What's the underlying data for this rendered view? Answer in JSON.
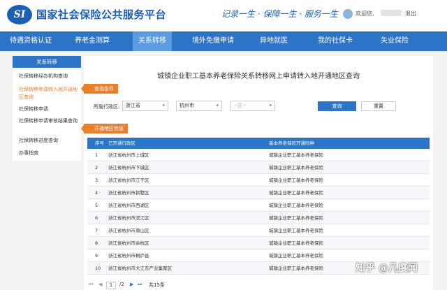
{
  "header": {
    "logo_text": "SI",
    "site_title": "国家社会保险公共服务平台",
    "slogan": "记录一生 · 保障一生 · 服务一生",
    "welcome": "欢迎您,",
    "logout": "退出"
  },
  "nav": [
    "待遇资格认证",
    "养老金测算",
    "关系转移",
    "境外免缴申请",
    "异地就医",
    "我的社保卡",
    "失业保险"
  ],
  "sidebar": {
    "header": "关系转移",
    "items": [
      "社保转移经办机构查询",
      "社保转移申请转入地开通地区查询",
      "社保转移申请",
      "社保转移申请审核结果查询",
      "社保转移进度查询",
      "办事指南"
    ]
  },
  "main": {
    "title": "城镇企业职工基本养老保险关系转移网上申请转入地开通地区查询",
    "query_tag": "查询条件",
    "filter_label": "所属行政区:",
    "province": "浙江省",
    "city": "杭州市",
    "district_placeholder": "--区--",
    "query_button": "查询",
    "reset_button": "重置",
    "open_tag": "开通地区信息"
  },
  "table": {
    "headers": [
      "序号",
      "已开通行政区",
      "基本养老保险开通险种"
    ],
    "rows": [
      [
        "1",
        "浙江省杭州市上城区",
        "城镇企业职工基本养老保险"
      ],
      [
        "2",
        "浙江省杭州市下城区",
        "城镇企业职工基本养老保险"
      ],
      [
        "3",
        "浙江省杭州市江干区",
        "城镇企业职工基本养老保险"
      ],
      [
        "4",
        "浙江省杭州市拱墅区",
        "城镇企业职工基本养老保险"
      ],
      [
        "5",
        "浙江省杭州市西湖区",
        "城镇企业职工基本养老保险"
      ],
      [
        "6",
        "浙江省杭州市滨江区",
        "城镇企业职工基本养老保险"
      ],
      [
        "7",
        "浙江省杭州市萧山区",
        "城镇企业职工基本养老保险"
      ],
      [
        "8",
        "浙江省杭州市余杭区",
        "城镇企业职工基本养老保险"
      ],
      [
        "9",
        "浙江省杭州市桐庐县",
        "城镇企业职工基本养老保险"
      ],
      [
        "10",
        "浙江省杭州市大江东产业集聚区",
        "城镇企业职工基本养老保险"
      ]
    ]
  },
  "pager": {
    "current": "1",
    "sep": "/2",
    "total": "共15条"
  },
  "watermark": "知乎 @几度闻"
}
